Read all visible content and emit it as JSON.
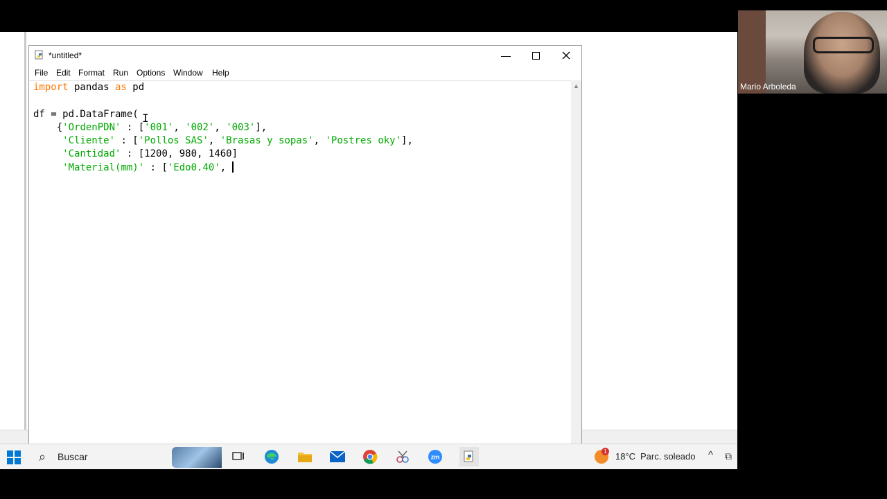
{
  "window": {
    "title": "*untitled*"
  },
  "menu": [
    "File",
    "Edit",
    "Format",
    "Run",
    "Options",
    "Window",
    "Help"
  ],
  "editor": {
    "lines": [
      [
        {
          "t": "import",
          "c": "kw"
        },
        {
          "t": " pandas ",
          "c": "plain"
        },
        {
          "t": "as",
          "c": "kw"
        },
        {
          "t": " pd",
          "c": "plain"
        }
      ],
      [],
      [
        {
          "t": "df = pd.DataFrame(",
          "c": "plain"
        }
      ],
      [
        {
          "t": "    {",
          "c": "plain"
        },
        {
          "t": "'OrdenPDN'",
          "c": "str"
        },
        {
          "t": " : [",
          "c": "plain"
        },
        {
          "t": "'001'",
          "c": "str"
        },
        {
          "t": ", ",
          "c": "plain"
        },
        {
          "t": "'002'",
          "c": "str"
        },
        {
          "t": ", ",
          "c": "plain"
        },
        {
          "t": "'003'",
          "c": "str"
        },
        {
          "t": "],",
          "c": "plain"
        }
      ],
      [
        {
          "t": "     ",
          "c": "plain"
        },
        {
          "t": "'Cliente'",
          "c": "str"
        },
        {
          "t": " : [",
          "c": "plain"
        },
        {
          "t": "'Pollos SAS'",
          "c": "str"
        },
        {
          "t": ", ",
          "c": "plain"
        },
        {
          "t": "'Brasas y sopas'",
          "c": "str"
        },
        {
          "t": ", ",
          "c": "plain"
        },
        {
          "t": "'Postres oky'",
          "c": "str"
        },
        {
          "t": "],",
          "c": "plain"
        }
      ],
      [
        {
          "t": "     ",
          "c": "plain"
        },
        {
          "t": "'Cantidad'",
          "c": "str"
        },
        {
          "t": " : [1200, 980, 1460]",
          "c": "plain"
        }
      ],
      [
        {
          "t": "     ",
          "c": "plain"
        },
        {
          "t": "'Material(mm)'",
          "c": "str"
        },
        {
          "t": " : [",
          "c": "plain"
        },
        {
          "t": "'Edo0.40'",
          "c": "str"
        },
        {
          "t": ", ",
          "c": "plain"
        }
      ]
    ],
    "caret_line": 6
  },
  "taskbar": {
    "search_label": "Buscar",
    "weather_temp": "18°C",
    "weather_condition": "Parc. soleado",
    "weather_badge": "1",
    "apps": [
      "task-view-icon",
      "edge-icon",
      "file-explorer-icon",
      "mail-icon",
      "chrome-icon",
      "snipping-icon",
      "zoom-icon",
      "python-idle-icon"
    ]
  },
  "video_call": {
    "participant_name": "Mario Arboleda"
  },
  "colors": {
    "keyword": "#ff7700",
    "string": "#00aa00",
    "accent": "#0078d4"
  }
}
